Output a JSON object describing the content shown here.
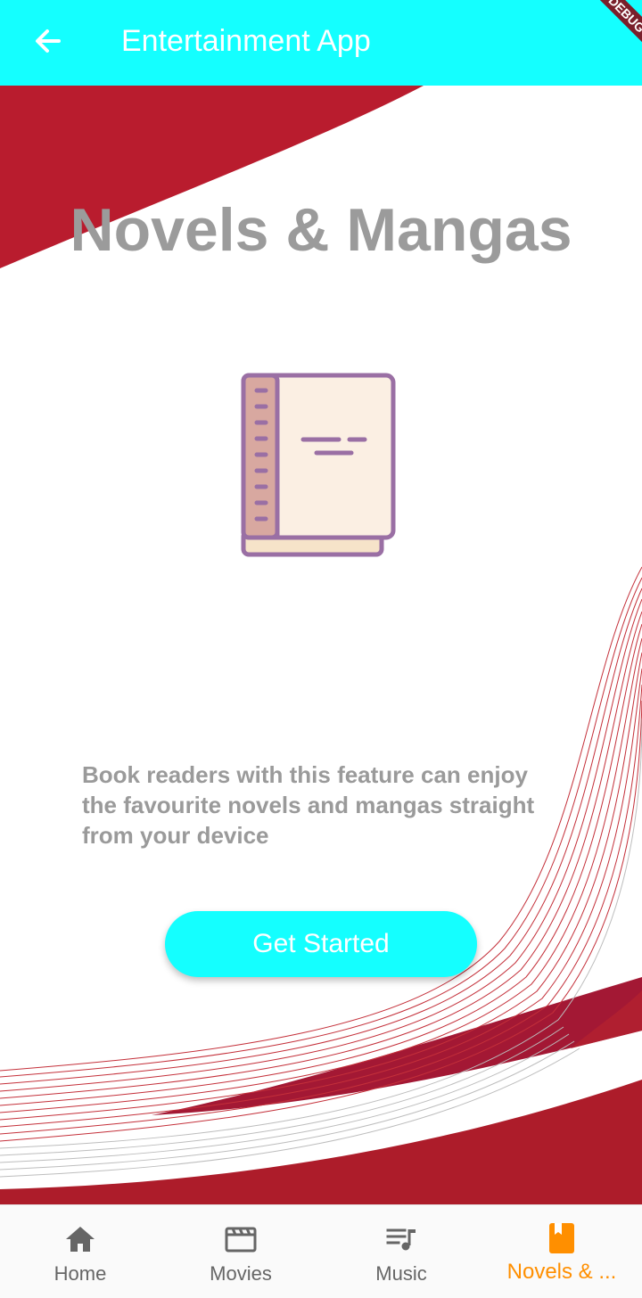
{
  "app_bar": {
    "title": "Entertainment App",
    "back_icon": "arrow-back-icon",
    "debug_banner": "DEBUG",
    "background": "#14ffff"
  },
  "main": {
    "headline": "Novels & Mangas",
    "illustration_icon": "book-icon",
    "description": "Book readers with this feature can enjoy the favourite novels and mangas straight from your device",
    "cta_label": "Get Started",
    "accent_red": "#b91c2e"
  },
  "bottom_nav": {
    "items": [
      {
        "label": "Home",
        "icon": "home-icon",
        "active": false
      },
      {
        "label": "Movies",
        "icon": "movie-clapper-icon",
        "active": false
      },
      {
        "label": "Music",
        "icon": "queue-music-icon",
        "active": false
      },
      {
        "label": "Novels & ...",
        "icon": "book-bookmark-icon",
        "active": true
      }
    ],
    "active_color": "#ff8f00",
    "inactive_color": "#666666"
  }
}
